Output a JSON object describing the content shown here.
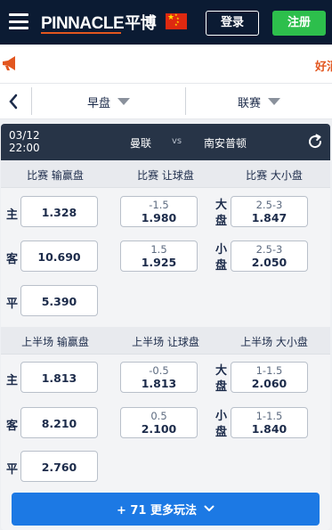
{
  "header": {
    "logo_text": "PINNACLE",
    "logo_cn": "平博",
    "login_label": "登录",
    "register_label": "注册",
    "flag_icon": "china-flag-icon",
    "colors": {
      "bar": "#0b1b33",
      "register": "#2dbf4c",
      "accent": "#e2561f"
    }
  },
  "announcement": {
    "text": "好消"
  },
  "filters": {
    "period_label": "早盘",
    "league_label": "联赛"
  },
  "match": {
    "date": "03/12",
    "time": "22:00",
    "home": "曼联",
    "vs": "vs",
    "away": "南安普顿"
  },
  "full_time": {
    "headers": [
      "比赛 输赢盘",
      "比赛 让球盘",
      "比赛 大小盘"
    ],
    "moneyline": [
      {
        "label": "主",
        "price": "1.328"
      },
      {
        "label": "客",
        "price": "10.690"
      },
      {
        "label": "平",
        "price": "5.390"
      }
    ],
    "handicap": [
      {
        "line": "-1.5",
        "price": "1.980"
      },
      {
        "line": "1.5",
        "price": "1.925"
      }
    ],
    "totals": [
      {
        "label_top": "大",
        "label_bottom": "盘",
        "line": "2.5-3",
        "price": "1.847"
      },
      {
        "label_top": "小",
        "label_bottom": "盘",
        "line": "2.5-3",
        "price": "2.050"
      }
    ]
  },
  "first_half": {
    "headers": [
      "上半场 输赢盘",
      "上半场 让球盘",
      "上半场 大小盘"
    ],
    "moneyline": [
      {
        "label": "主",
        "price": "1.813"
      },
      {
        "label": "客",
        "price": "8.210"
      },
      {
        "label": "平",
        "price": "2.760"
      }
    ],
    "handicap": [
      {
        "line": "-0.5",
        "price": "1.813"
      },
      {
        "line": "0.5",
        "price": "2.100"
      }
    ],
    "totals": [
      {
        "label_top": "大",
        "label_bottom": "盘",
        "line": "1-1.5",
        "price": "2.060"
      },
      {
        "label_top": "小",
        "label_bottom": "盘",
        "line": "1-1.5",
        "price": "1.840"
      }
    ]
  },
  "more_button": {
    "label": "+ 71 更多玩法"
  }
}
